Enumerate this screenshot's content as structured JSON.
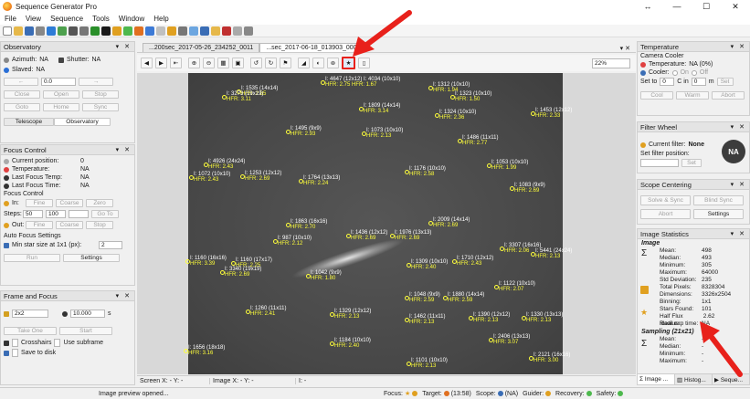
{
  "window": {
    "title": "Sequence Generator Pro",
    "min": "—",
    "max": "☐",
    "close": "✕",
    "restore": "↔"
  },
  "menu": [
    "File",
    "View",
    "Sequence",
    "Tools",
    "Window",
    "Help"
  ],
  "observatory": {
    "title": "Observatory",
    "azimuth_label": "Azimuth:",
    "azimuth_value": "NA",
    "shutter_label": "Shutter:",
    "shutter_value": "NA",
    "slaved_label": "Slaved:",
    "slaved_value": "NA",
    "step_value": "0.0",
    "close": "Close",
    "open": "Open",
    "stop": "Stop",
    "goto": "Goto",
    "home": "Home",
    "sync": "Sync",
    "tab_telescope": "Telescope",
    "tab_observatory": "Observatory"
  },
  "focus": {
    "title": "Focus Control",
    "current_position_label": "Current position:",
    "current_position": "0",
    "temperature_label": "Temperature:",
    "temperature": "NA",
    "last_temp_label": "Last Focus Temp:",
    "last_temp": "NA",
    "last_time_label": "Last Focus Time:",
    "last_time": "NA",
    "control_label": "Focus Control",
    "in_label": "In:",
    "fine": "Fine",
    "coarse": "Coarse",
    "zero": "Zero",
    "steps_label": "Steps:",
    "steps_value": "50",
    "steps_value2": "100",
    "goto": "Go To",
    "out_label": "Out:",
    "auto_label": "Auto Focus Settings",
    "min_star_label": "Min star size at 1x1 (px):",
    "min_star_value": "2",
    "run": "Run",
    "settings": "Settings"
  },
  "frame": {
    "title": "Frame and Focus",
    "binning": "2x2",
    "exposure": "10.000",
    "exposure_unit": "s",
    "take_one": "Take One",
    "start": "Start",
    "crosshairs": "Crosshairs",
    "use_subframe": "Use subframe",
    "save_to_disk": "Save to disk"
  },
  "tabs": {
    "tab1": "...200sec_2017-05-26_234252_0011",
    "tab2": "...sec_2017-06-18_013903_0009"
  },
  "zoom": "22%",
  "image_status": {
    "screen_x": "Screen X: - Y: -",
    "image_x": "Image X: - Y: -",
    "i": "I: -"
  },
  "stars": [
    {
      "i": "I: 4647 (12x12)",
      "i2": "I: 4034 (10x10)",
      "hfr": "HFR: 2.75",
      "hfr2": "HFR: 1.67"
    },
    {
      "i": "I: 1535 (14x14)",
      "hfr": "HFR: 2.85"
    },
    {
      "i": "I: 3273 (19x19)",
      "hfr": "HFR: 3.11"
    },
    {
      "i": "I: 1312 (10x10)",
      "hfr": "HFR: 1.94"
    },
    {
      "i": "I: 1323 (10x10)",
      "hfr": "HFR: 1.50"
    },
    {
      "i": "I: 1809 (14x14)",
      "hfr": "HFR: 3.14"
    },
    {
      "i": "I: 1324 (10x10)",
      "hfr": "HFR: 2.36"
    },
    {
      "i": "I: 1453 (12x12)",
      "hfr": "HFR: 2.33"
    },
    {
      "i": "I: 1495 (9x9)",
      "hfr": "HFR: 2.93"
    },
    {
      "i": "I: 1073 (10x10)",
      "hfr": "HFR: 2.13"
    },
    {
      "i": "I: 1486 (11x11)",
      "hfr": "HFR: 2.77"
    },
    {
      "i": "I: 4926 (24x24)",
      "hfr": "HFR: 2.43"
    },
    {
      "i": "I: 1253 (12x12)",
      "hfr": "HFR: 2.69"
    },
    {
      "i": "I: 1072 (10x10)",
      "hfr": "HFR: 2.43"
    },
    {
      "i": "I: 1176 (10x10)",
      "hfr": "HFR: 2.58"
    },
    {
      "i": "I: 1764 (13x13)",
      "hfr": "HFR: 2.24"
    },
    {
      "i": "I: 1053 (10x10)",
      "hfr": "HFR: 1.99"
    },
    {
      "i": "I: 1083 (9x9)",
      "hfr": "HFR: 2.69"
    },
    {
      "i": "I: 2009 (14x14)",
      "hfr": "HFR: 2.69"
    },
    {
      "i": "I: 1863 (16x16)",
      "hfr": "HFR: 2.70"
    },
    {
      "i": "I: 1436 (12x12)",
      "hfr": "HFR: 2.69"
    },
    {
      "i": "I: 1976 (13x13)",
      "hfr": "HFR: 2.69"
    },
    {
      "i": "I: 987 (10x10)",
      "hfr": "HFR: 2.12"
    },
    {
      "i": "I: 1160 (16x16)",
      "hfr": "HFR: 3.39"
    },
    {
      "i": "I: 1160 (17x17)",
      "hfr": "HFR: 2.25"
    },
    {
      "i": "I: 3340 (19x19)",
      "hfr": "HFR: 2.69"
    },
    {
      "i": "I: 1309 (10x10)",
      "hfr": "HFR: 2.40"
    },
    {
      "i": "I: 1710 (12x12)",
      "hfr": "HFR: 2.43"
    },
    {
      "i": "I: 3307 (16x16)",
      "hfr": "HFR: 2.06"
    },
    {
      "i": "I: 5441 (24x24)",
      "hfr": "HFR: 2.13"
    },
    {
      "i": "I: 1042 (9x9)",
      "hfr": "HFR: 1.80"
    },
    {
      "i": "I: 1122 (10x10)",
      "hfr": "HFR: 2.07"
    },
    {
      "i": "I: 1880 (14x14)",
      "hfr": "HFR: 2.59"
    },
    {
      "i": "I: 1048 (9x9)",
      "hfr": "HFR: 2.59"
    },
    {
      "i": "I: 1260 (11x11)",
      "hfr": "HFR: 2.41"
    },
    {
      "i": "I: 1329 (12x12)",
      "hfr": "HFR: 2.13"
    },
    {
      "i": "I: 1462 (11x11)",
      "hfr": "HFR: 2.13"
    },
    {
      "i": "I: 1390 (12x12)",
      "hfr": "HFR: 2.13"
    },
    {
      "i": "I: 1330 (13x13)",
      "hfr": "HFR: 2.13"
    },
    {
      "i": "I: 2406 (13x13)",
      "hfr": "HFR: 3.07"
    },
    {
      "i": "I: 1184 (10x10)",
      "hfr": "HFR: 2.40"
    },
    {
      "i": "I: 1656 (18x18)",
      "hfr": "HFR: 3.16"
    },
    {
      "i": "I: 1101 (10x10)",
      "hfr": "HFR: 2.13"
    },
    {
      "i": "I: 2121 (16x16)",
      "hfr": "HFR: 3.00"
    }
  ],
  "temperature": {
    "title": "Temperature",
    "camera_cooler": "Camera Cooler",
    "temp_label": "Temperature:",
    "temp_value": "NA (0%)",
    "cooler_label": "Cooler:",
    "on": "On",
    "off": "Off",
    "set_to_label": "Set to",
    "set_to_value": "0",
    "c_in": "C in",
    "c_in_value": "0",
    "m": "m",
    "set": "Set",
    "cool": "Cool",
    "warm": "Warm",
    "abort": "Abort"
  },
  "filter_wheel": {
    "title": "Filter Wheel",
    "current_filter_label": "Current filter:",
    "current_filter": "None",
    "set_filter_label": "Set filter position:",
    "set": "Set",
    "badge": "NA"
  },
  "scope_centering": {
    "title": "Scope Centering",
    "solve_sync": "Solve & Sync",
    "blind_sync": "Blind Sync",
    "abort": "Abort",
    "settings": "Settings"
  },
  "image_stats": {
    "title": "Image Statistics",
    "image_label": "Image",
    "rows": [
      {
        "k": "Mean:",
        "v": "498"
      },
      {
        "k": "Median:",
        "v": "493"
      },
      {
        "k": "Minimum:",
        "v": "305"
      },
      {
        "k": "Maximum:",
        "v": "64000"
      },
      {
        "k": "Std Deviation:",
        "v": "235"
      },
      {
        "k": "Total Pixels:",
        "v": "8328304"
      },
      {
        "k": "Dimensions:",
        "v": "3326x2504"
      },
      {
        "k": "Binning:",
        "v": "1x1"
      },
      {
        "k": "Stars Found:",
        "v": "101"
      },
      {
        "k": "Half Flux Radius:",
        "v": "2.62"
      },
      {
        "k": "Ideal exp time:",
        "v": "NA"
      }
    ],
    "sampling_label": "Sampling (21x21)",
    "sampling_rows": [
      {
        "k": "Mean:",
        "v": "-"
      },
      {
        "k": "Median:",
        "v": "-"
      },
      {
        "k": "Minimum:",
        "v": "-"
      },
      {
        "k": "Maximum:",
        "v": "-"
      }
    ],
    "tab_image": "Image ...",
    "tab_histogram": "Histog...",
    "tab_sequence": "Seque..."
  },
  "status": {
    "message": "Image preview opened...",
    "focus": "Focus:",
    "target": "Target:",
    "target_time": "(13:58)",
    "scope": "Scope:",
    "scope_na": "(NA)",
    "guider": "Guider:",
    "recovery": "Recovery:",
    "safety": "Safety:"
  },
  "colors": {
    "accent_red": "#e8211b",
    "star_yellow": "#ffff3a",
    "sky": "#4c4c4c"
  }
}
